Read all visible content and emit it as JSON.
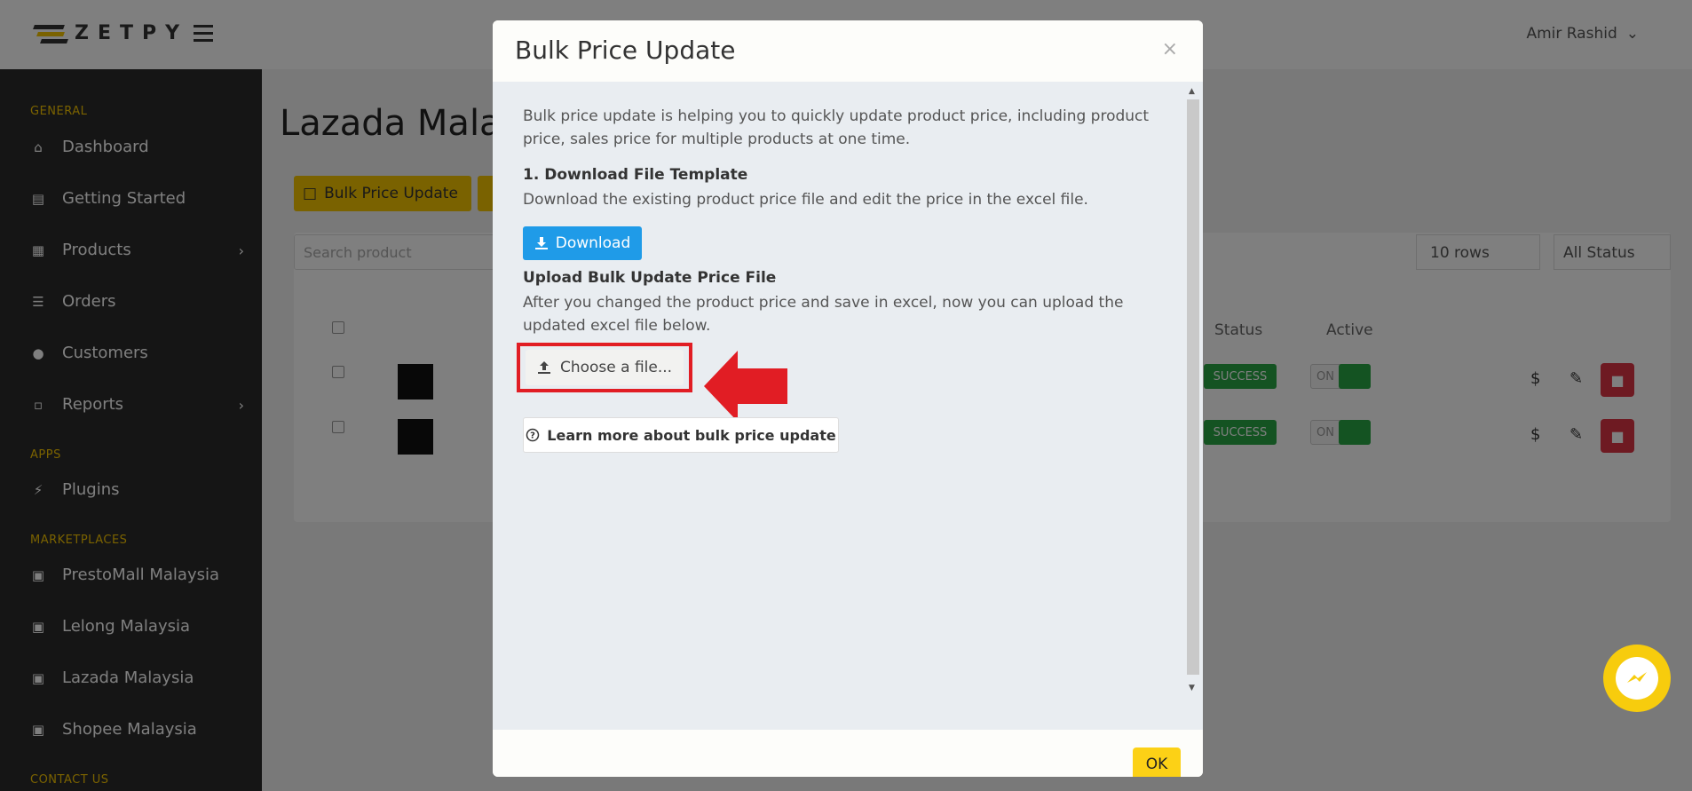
{
  "app": {
    "brand": "ZETPY",
    "user_name": "Amir Rashid"
  },
  "sidebar": {
    "sections": [
      {
        "label": "GENERAL"
      },
      {
        "label": "APPS"
      },
      {
        "label": "MARKETPLACES"
      },
      {
        "label": "CONTACT US"
      }
    ],
    "items": [
      {
        "label": "Dashboard",
        "icon": "home-icon"
      },
      {
        "label": "Getting Started",
        "icon": "book-icon"
      },
      {
        "label": "Products",
        "icon": "boxes-icon"
      },
      {
        "label": "Orders",
        "icon": "list-icon"
      },
      {
        "label": "Customers",
        "icon": "users-icon"
      },
      {
        "label": "Reports",
        "icon": "chart-icon"
      },
      {
        "label": "Plugins",
        "icon": "plug-icon"
      },
      {
        "label": "PrestoMall Malaysia",
        "icon": "store-icon"
      },
      {
        "label": "Lelong Malaysia",
        "icon": "store-icon"
      },
      {
        "label": "Lazada Malaysia",
        "icon": "store-icon"
      },
      {
        "label": "Shopee Malaysia",
        "icon": "store-icon"
      }
    ]
  },
  "main": {
    "page_title": "Lazada Mala",
    "bulk_button_label": "Bulk Price Update",
    "search_placeholder": "Search product",
    "rows_select": "10 rows",
    "status_select": "All Status",
    "columns": {
      "status": "Status",
      "active": "Active"
    },
    "rows": [
      {
        "status": "SUCCESS",
        "toggle": "ON"
      },
      {
        "status": "SUCCESS",
        "toggle": "ON"
      }
    ]
  },
  "modal": {
    "title": "Bulk Price Update",
    "close_symbol": "×",
    "intro": "Bulk price update is helping you to quickly update product price, including product price, sales price for multiple products at one time.",
    "step1_title": "1. Download File Template",
    "step1_desc": "Download the existing product price file and edit the price in the excel file.",
    "download_label": "Download",
    "step2_title": "Upload Bulk Update Price File",
    "step2_desc": "After you changed the product price and save in excel, now you can upload the updated excel file below.",
    "choose_file_label": "Choose a file...",
    "learn_more_label": "Learn more about bulk price update",
    "ok_label": "OK"
  },
  "colors": {
    "accent_yellow": "#fcd116",
    "download_blue": "#1f9be8",
    "highlight_red": "#e11d24",
    "sidebar_bg": "#2b2b2b"
  }
}
